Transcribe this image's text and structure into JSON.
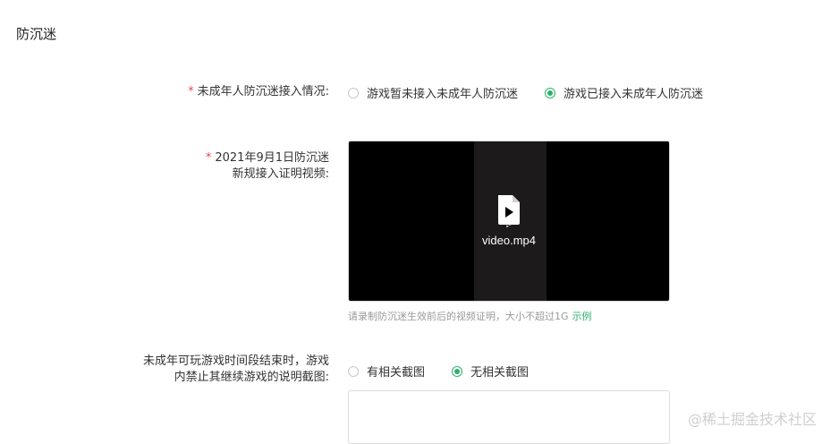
{
  "section": {
    "title": "防沉迷"
  },
  "minor_integration": {
    "required_mark": "*",
    "label": "未成年人防沉迷接入情况:",
    "options": [
      {
        "label": "游戏暂未接入未成年人防沉迷",
        "checked": false
      },
      {
        "label": "游戏已接入未成年人防沉迷",
        "checked": true
      }
    ]
  },
  "proof_video": {
    "required_mark": "*",
    "label_line1": "2021年9月1日防沉迷",
    "label_line2": "新规接入证明视频:",
    "filename": "video.mp4",
    "icon": "video-file-icon",
    "hint_text": "请录制防沉迷生效前后的视频证明，大小不超过1G",
    "hint_link": "示例"
  },
  "screenshot_section": {
    "label_line1": "未成年可玩游戏时间段结束时，游戏",
    "label_line2": "内禁止其继续游戏的说明截图:",
    "options": [
      {
        "label": "有相关截图",
        "checked": false
      },
      {
        "label": "无相关截图",
        "checked": true
      }
    ]
  },
  "watermark": "@稀土掘金技术社区",
  "colors": {
    "accent": "#2db16b",
    "required": "#e5484d",
    "hint": "#9a9a9a"
  }
}
